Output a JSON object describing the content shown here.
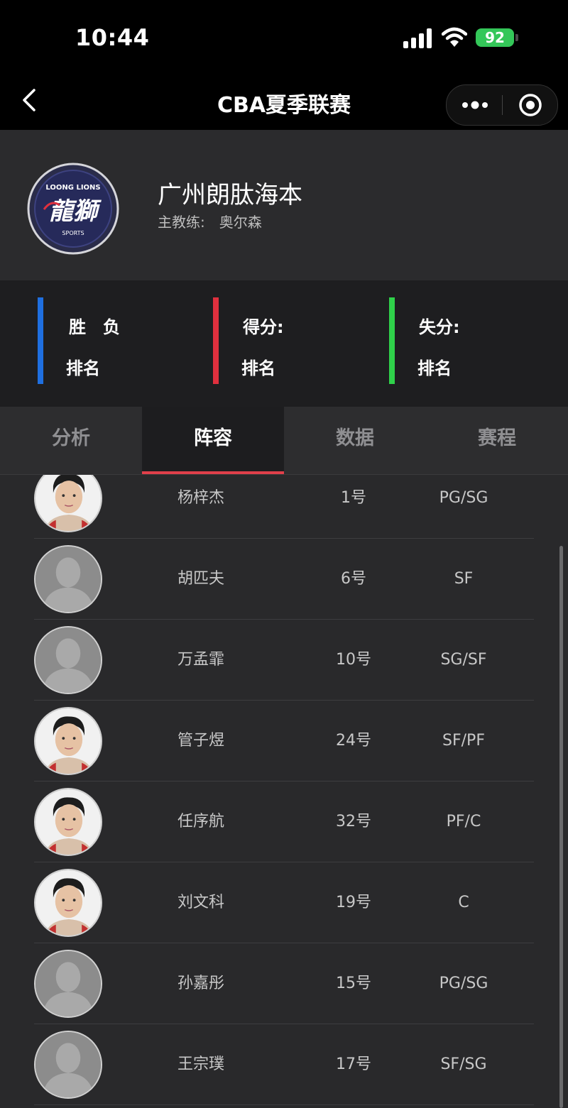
{
  "status_bar": {
    "time": "10:44",
    "battery": "92"
  },
  "nav": {
    "title": "CBA夏季联赛",
    "back_icon": "chevron-left-icon",
    "more_icon": "more-dots-icon",
    "close_icon": "target-circle-icon"
  },
  "team": {
    "name": "广州朗肽海本",
    "coach_label": "主教练:",
    "coach_name": "奥尔森",
    "logo_text": "龍獅",
    "logo_top_text": "LOONG LIONS",
    "logo_bottom_text": "SPORTS"
  },
  "stats": [
    {
      "line1": "胜　负",
      "line2": "排名",
      "color": "#1f6fe0"
    },
    {
      "line1": "得分:",
      "line2": "排名",
      "color": "#e0303e"
    },
    {
      "line1": "失分:",
      "line2": "排名",
      "color": "#2fd14a"
    }
  ],
  "tabs": [
    {
      "label": "分析",
      "active": false
    },
    {
      "label": "阵容",
      "active": true
    },
    {
      "label": "数据",
      "active": false
    },
    {
      "label": "赛程",
      "active": false
    }
  ],
  "roster": [
    {
      "name": "杨梓杰",
      "number": "1号",
      "position": "PG/SG",
      "has_photo": true
    },
    {
      "name": "胡匹夫",
      "number": "6号",
      "position": "SF",
      "has_photo": false
    },
    {
      "name": "万孟霏",
      "number": "10号",
      "position": "SG/SF",
      "has_photo": false
    },
    {
      "name": "管子煜",
      "number": "24号",
      "position": "SF/PF",
      "has_photo": true
    },
    {
      "name": "任序航",
      "number": "32号",
      "position": "PF/C",
      "has_photo": true
    },
    {
      "name": "刘文科",
      "number": "19号",
      "position": "C",
      "has_photo": true
    },
    {
      "name": "孙嘉彤",
      "number": "15号",
      "position": "PG/SG",
      "has_photo": false
    },
    {
      "name": "王宗璞",
      "number": "17号",
      "position": "SF/SG",
      "has_photo": false
    }
  ]
}
